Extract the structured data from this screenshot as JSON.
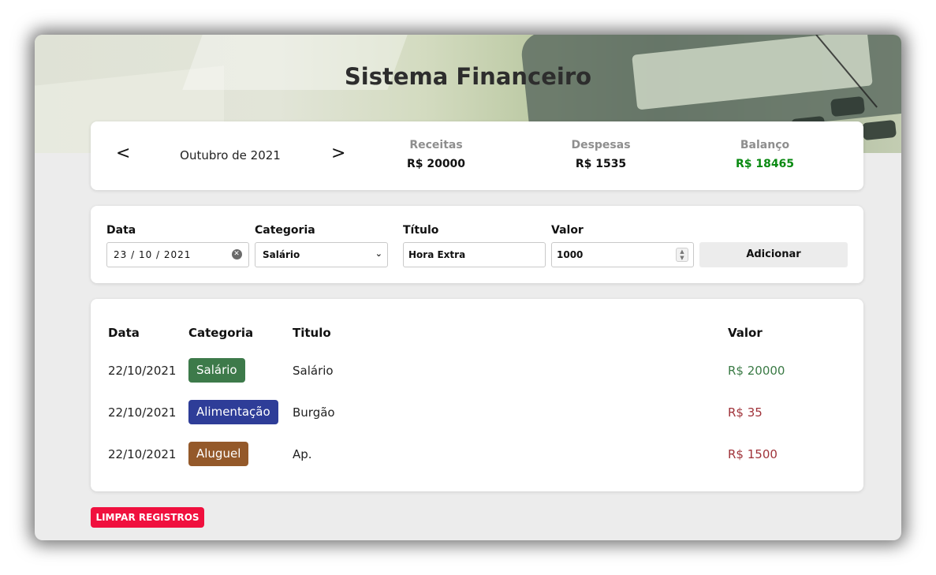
{
  "app": {
    "title": "Sistema Financeiro"
  },
  "summary": {
    "prev_icon": "<",
    "next_icon": ">",
    "month": "Outubro de 2021",
    "receitas_label": "Receitas",
    "receitas_value": "R$ 20000",
    "despesas_label": "Despesas",
    "despesas_value": "R$ 1535",
    "balanco_label": "Balanço",
    "balanco_value": "R$ 18465",
    "balanco_color": "#0a8a12"
  },
  "form": {
    "date_label": "Data",
    "date_value": "23 / 10 / 2021",
    "category_label": "Categoria",
    "category_value": "Salário",
    "title_label": "Título",
    "title_value": "Hora Extra",
    "value_label": "Valor",
    "value_value": "1000",
    "add_button": "Adicionar"
  },
  "table": {
    "headers": {
      "date": "Data",
      "category": "Categoria",
      "title": "Titulo",
      "value": "Valor"
    },
    "rows": [
      {
        "date": "22/10/2021",
        "category": "Salário",
        "category_color": "#3d7a4a",
        "title": "Salário",
        "value": "R$ 20000",
        "type": "receita"
      },
      {
        "date": "22/10/2021",
        "category": "Alimentação",
        "category_color": "#2e3d98",
        "title": "Burgão",
        "value": "R$ 35",
        "type": "despesa"
      },
      {
        "date": "22/10/2021",
        "category": "Aluguel",
        "category_color": "#94592a",
        "title": "Ap.",
        "value": "R$ 1500",
        "type": "despesa"
      }
    ]
  },
  "actions": {
    "clear_button": "LIMPAR REGISTROS",
    "clear_color": "#f0103e"
  }
}
